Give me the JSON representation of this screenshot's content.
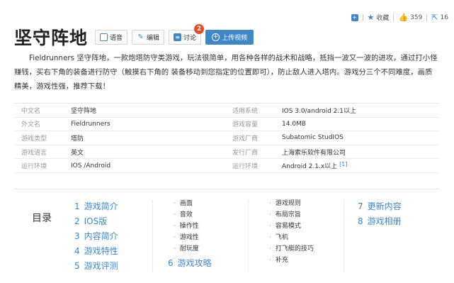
{
  "top_actions": {
    "favorite": "收藏",
    "like_count": "359",
    "share_count": "16"
  },
  "title": "坚守阵地",
  "buttons": {
    "audio": "语音",
    "edit": "编辑",
    "discuss": "讨论",
    "discuss_badge": "2",
    "upload": "上传视频"
  },
  "summary": "Fieldrunners 坚守阵地，一款炮塔防守类游戏，玩法很简单，用各种各样的战术和战略，抵挡一波又一波的进攻，通过打小怪赚钱，买右下角的装备进行防守（触摸右下角的 装备移动到您指定的位置即可），防止敌人进入塔内。游戏分三个不同难度，画质精美，游戏性强，推荐下载！",
  "info": [
    {
      "k1": "中文名",
      "v1": "坚守阵地",
      "k2": "适用系统",
      "v2": "IOS 3.0/android 2.1以上",
      "sup": ""
    },
    {
      "k1": "外文名",
      "v1": "Fieldrunners",
      "k2": "游戏容量",
      "v2": "14.0MB",
      "sup": ""
    },
    {
      "k1": "游戏类型",
      "v1": "塔防",
      "k2": "游戏厂商",
      "v2": "Subatomic StudIOS",
      "sup": ""
    },
    {
      "k1": "游戏语言",
      "v1": "英文",
      "k2": "发行厂商",
      "v2": "上海索乐软件有限公司",
      "sup": ""
    },
    {
      "k1": "运行环境",
      "v1": "IOS /Android",
      "k2": "运行环境",
      "v2": "Android 2.1.x以上",
      "sup": "[1]"
    }
  ],
  "catalog": {
    "title": "目录",
    "col1": [
      {
        "num": "1",
        "label": "游戏简介"
      },
      {
        "num": "2",
        "label": "IOS版"
      },
      {
        "num": "3",
        "label": "内容简介"
      },
      {
        "num": "4",
        "label": "游戏特性"
      },
      {
        "num": "5",
        "label": "游戏评测"
      }
    ],
    "col2_subs": [
      "画面",
      "音效",
      "操作性",
      "游戏性",
      "耐玩度"
    ],
    "col2_main": {
      "num": "6",
      "label": "游戏攻略"
    },
    "col3_subs": [
      "游戏规则",
      "布局宗旨",
      "容易模式",
      "飞机",
      "打飞艇的技巧",
      "补充"
    ],
    "col4": [
      {
        "num": "7",
        "label": "更新内容"
      },
      {
        "num": "8",
        "label": "游戏相册"
      }
    ]
  }
}
